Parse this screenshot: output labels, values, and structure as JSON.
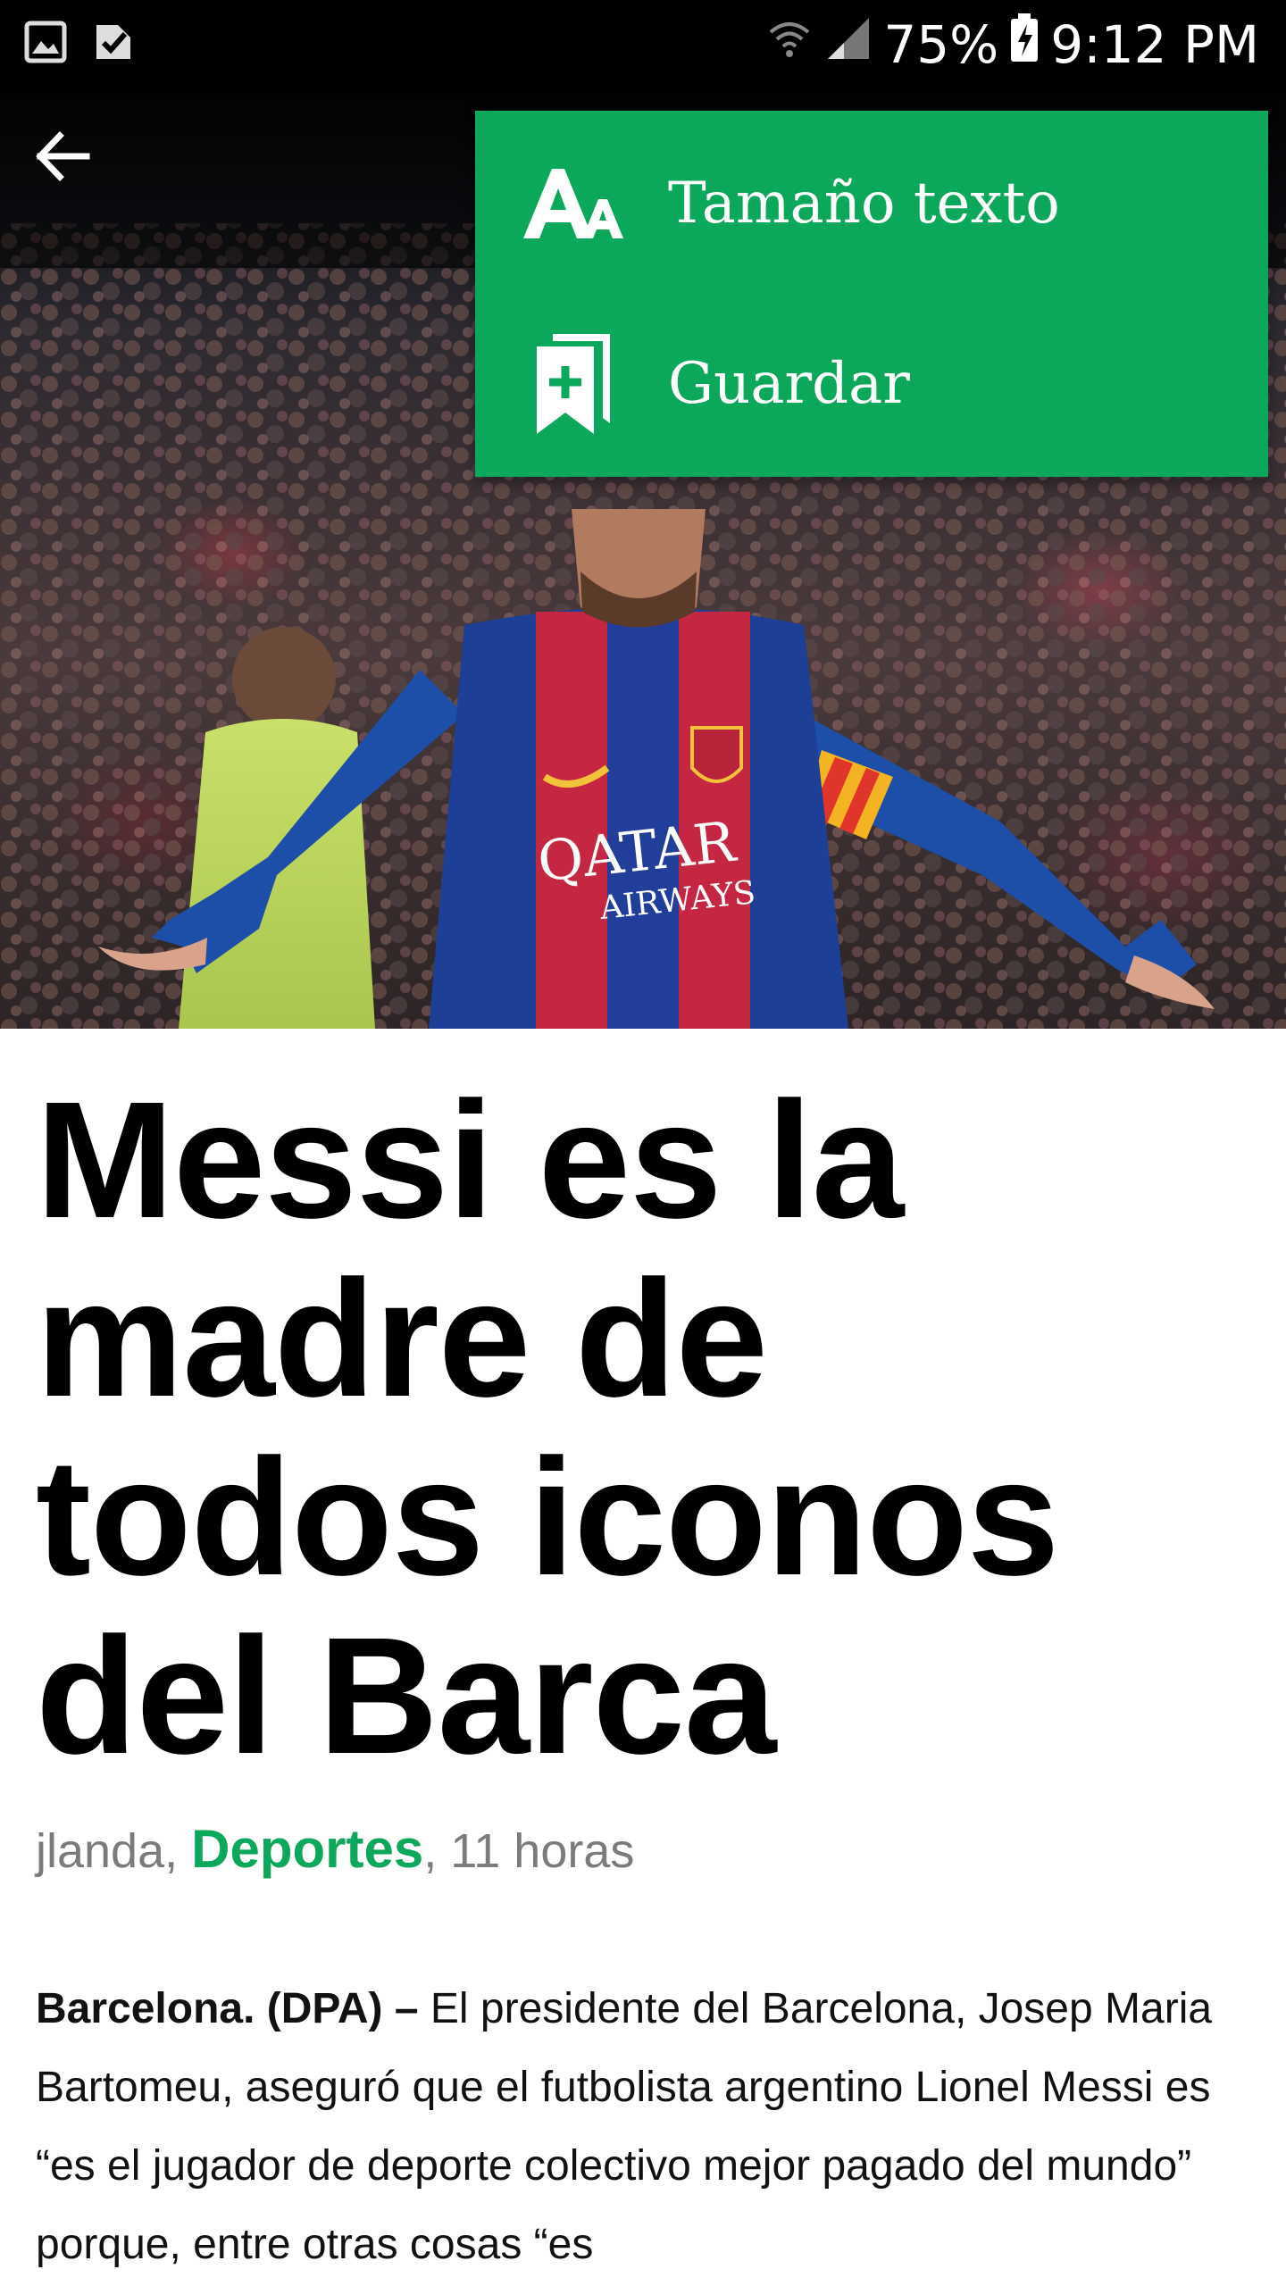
{
  "status_bar": {
    "icons_left": [
      "gallery-icon",
      "task-check-icon"
    ],
    "icons_right": [
      "wifi-icon",
      "cell-signal-icon",
      "battery-charging-icon"
    ],
    "battery": "75%",
    "time": "9:12 PM"
  },
  "toolbar": {
    "back_icon": "arrow-left-icon"
  },
  "menu": {
    "background": "#0ba75a",
    "items": [
      {
        "icon": "text-size-icon",
        "label": "Tamaño texto"
      },
      {
        "icon": "bookmark-add-icon",
        "label": "Guardar"
      }
    ]
  },
  "hero": {
    "jersey_text_1": "QATAR",
    "jersey_text_2": "AIRWAYS"
  },
  "article": {
    "headline": "Messi es la madre de todos iconos del Barca",
    "author": "jlanda,",
    "section": "Deportes",
    "time_ago": ", 11 horas",
    "dateline": "Barcelona. (DPA) –",
    "body": " El presidente del Barcelona, Josep Maria Bartomeu, aseguró que el futbolista argentino Lionel Messi es “es el jugador de deporte colectivo mejor pagado del mundo” porque, entre otras cosas “es"
  },
  "colors": {
    "accent": "#0ba75a",
    "status_bar": "#000000",
    "byline_gray": "#7b7b7b"
  }
}
